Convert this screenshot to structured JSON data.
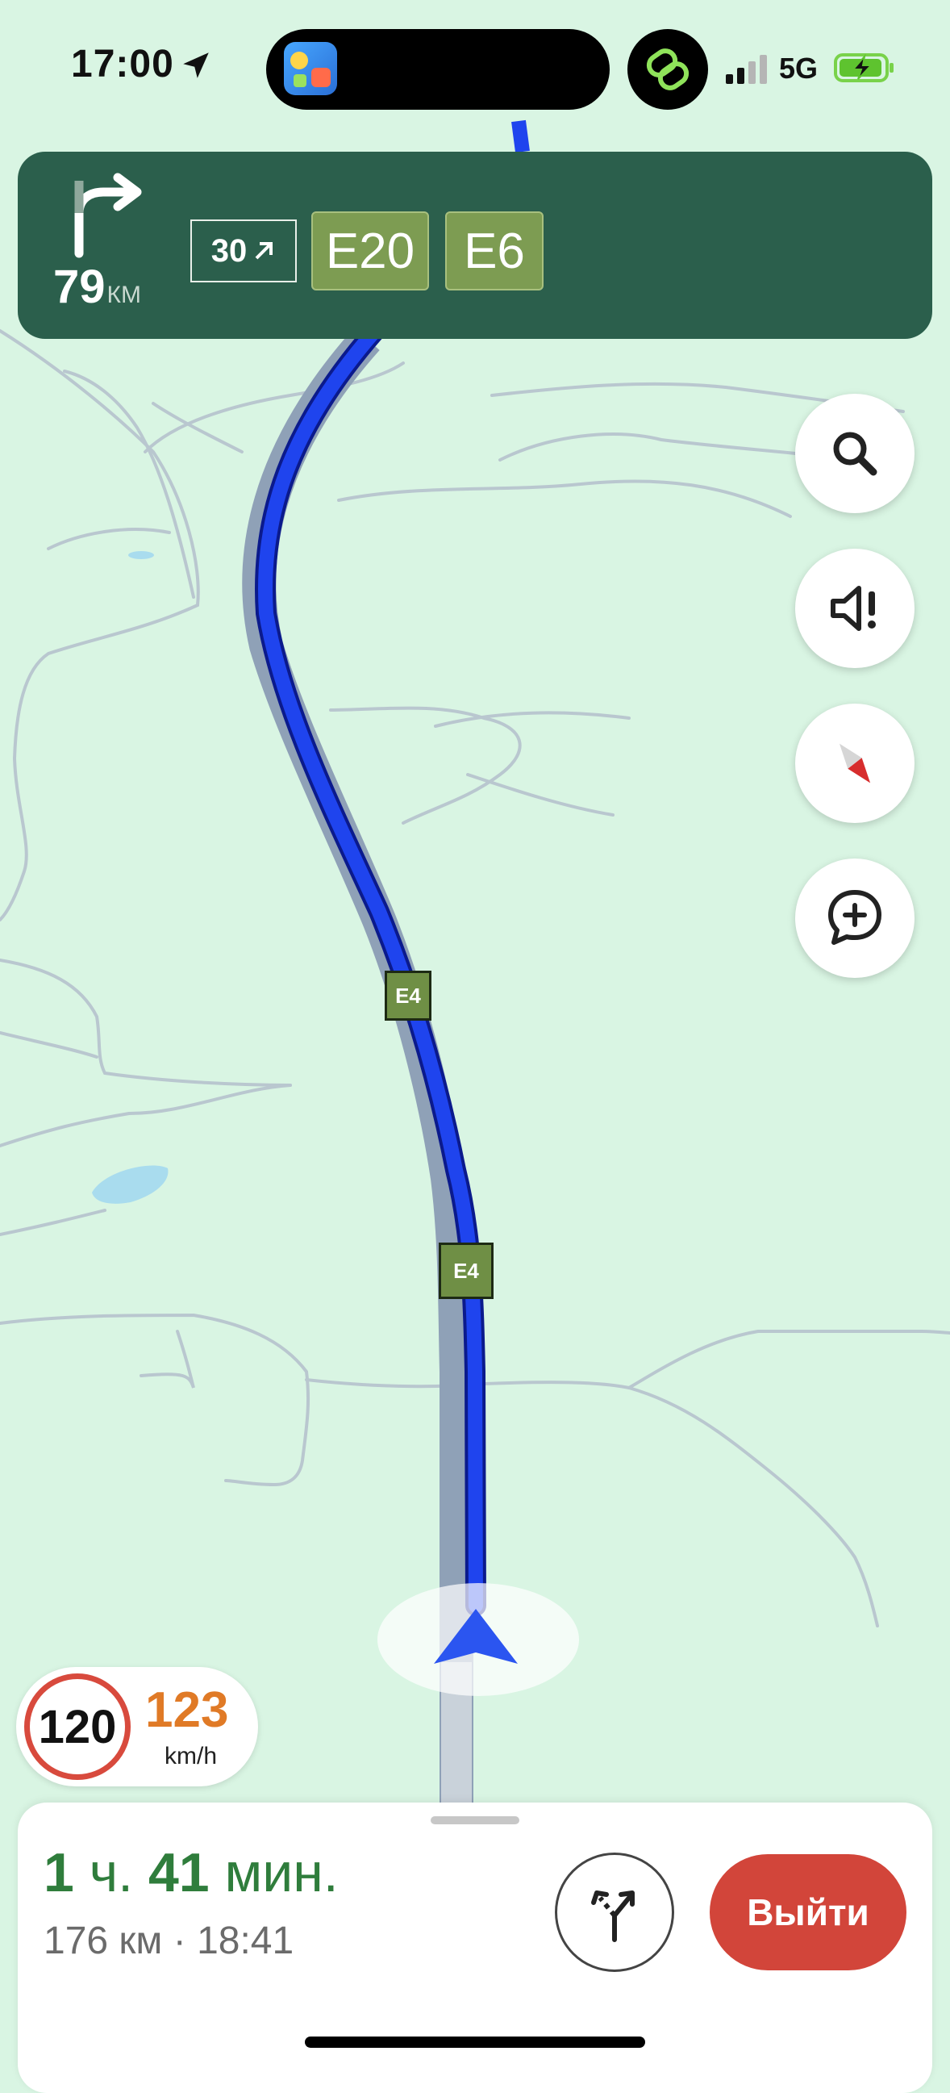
{
  "status_bar": {
    "time": "17:00",
    "network": "5G"
  },
  "maneuver": {
    "distance_value": "79",
    "distance_unit": "КМ",
    "exit_number": "30",
    "road_signs": [
      "E20",
      "E6"
    ]
  },
  "map": {
    "road_shields": [
      "E4",
      "E4"
    ]
  },
  "map_buttons": {
    "icons": [
      "search-icon",
      "sound-alert-icon",
      "compass-icon",
      "add-report-icon"
    ]
  },
  "speed": {
    "limit": "120",
    "current": "123",
    "unit": "km/h"
  },
  "trip": {
    "hours_value": "1",
    "hours_unit": "ч.",
    "minutes_value": "41",
    "minutes_unit": "мин.",
    "distance_arrival": "176 км · 18:41",
    "exit_label": "Выйти"
  },
  "colors": {
    "banner": "#2b5f4c",
    "road_sign": "#7d9c52",
    "route": "#1a3ee8",
    "exit_button": "#d2453a",
    "eta_text": "#2f7d3c",
    "speed_current": "#e07a26"
  }
}
